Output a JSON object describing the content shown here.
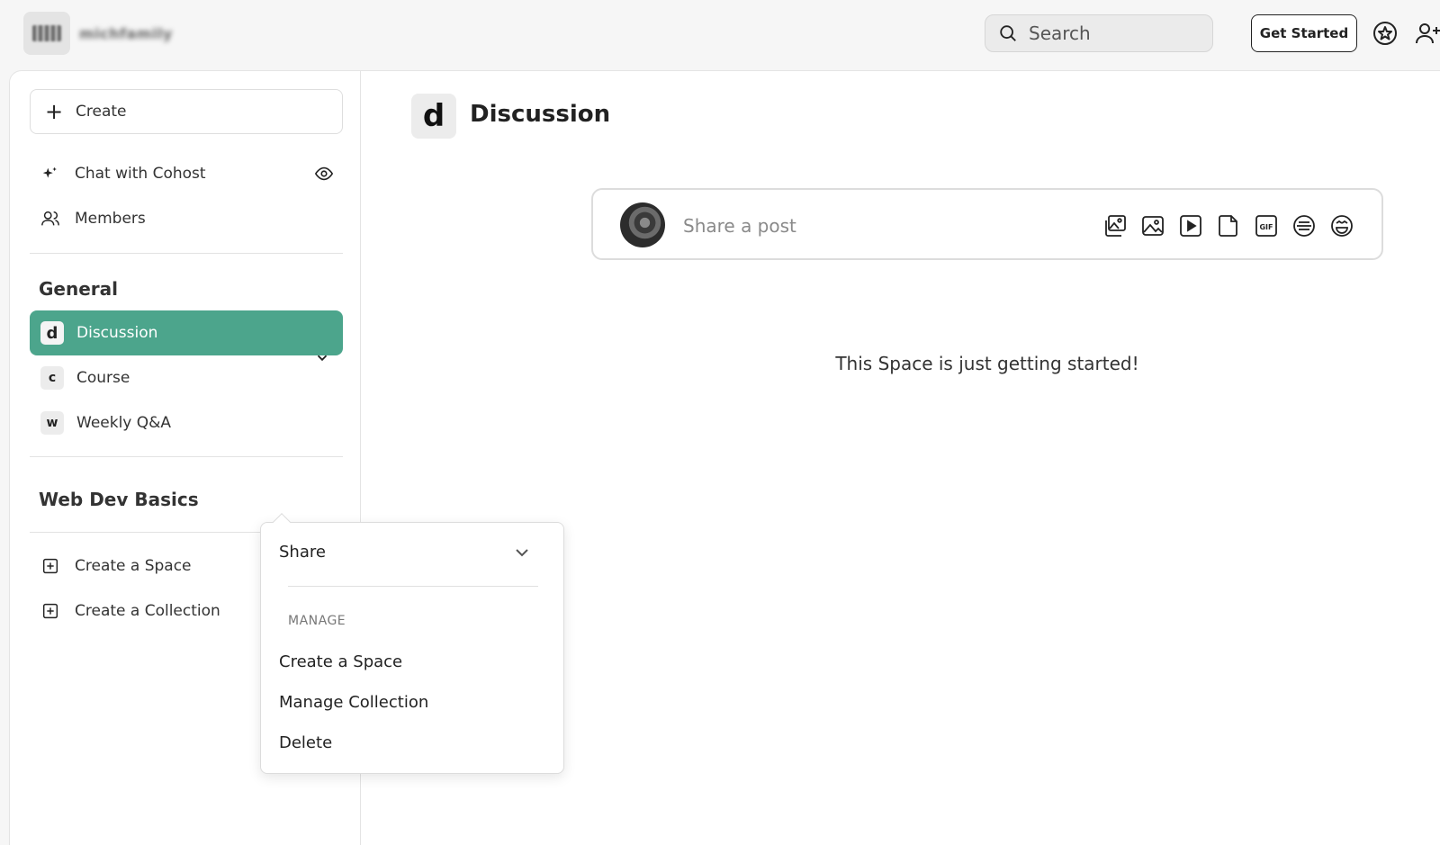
{
  "topbar": {
    "logo_text": "michfamily",
    "search_placeholder": "Search",
    "get_started_label": "Get Started"
  },
  "sidebar": {
    "create_label": "Create",
    "nav": [
      {
        "label": "Chat with Cohost",
        "icon": "sparkle-icon"
      },
      {
        "label": "Members",
        "icon": "members-icon"
      }
    ],
    "general": {
      "title": "General",
      "spaces": [
        {
          "badge": "d",
          "label": "Discussion",
          "active": true
        },
        {
          "badge": "c",
          "label": "Course",
          "active": false
        },
        {
          "badge": "w",
          "label": "Weekly Q&A",
          "active": false
        }
      ]
    },
    "collection_title": "Web Dev Basics",
    "footer": [
      {
        "label": "Create a Space"
      },
      {
        "label": "Create a Collection"
      }
    ]
  },
  "main": {
    "space_badge": "d",
    "space_title": "Discussion",
    "composer_placeholder": "Share a post",
    "composer_tools": [
      "gallery-icon",
      "image-icon",
      "video-icon",
      "file-icon",
      "gif-icon",
      "poll-icon",
      "emoji-icon"
    ],
    "gif_text": "GIF",
    "empty_message": "This Space is just getting started!"
  },
  "menu": {
    "share_label": "Share",
    "section_label": "MANAGE",
    "items": [
      "Create a Space",
      "Manage Collection",
      "Delete"
    ]
  },
  "colors": {
    "accent": "#4ca58c"
  }
}
